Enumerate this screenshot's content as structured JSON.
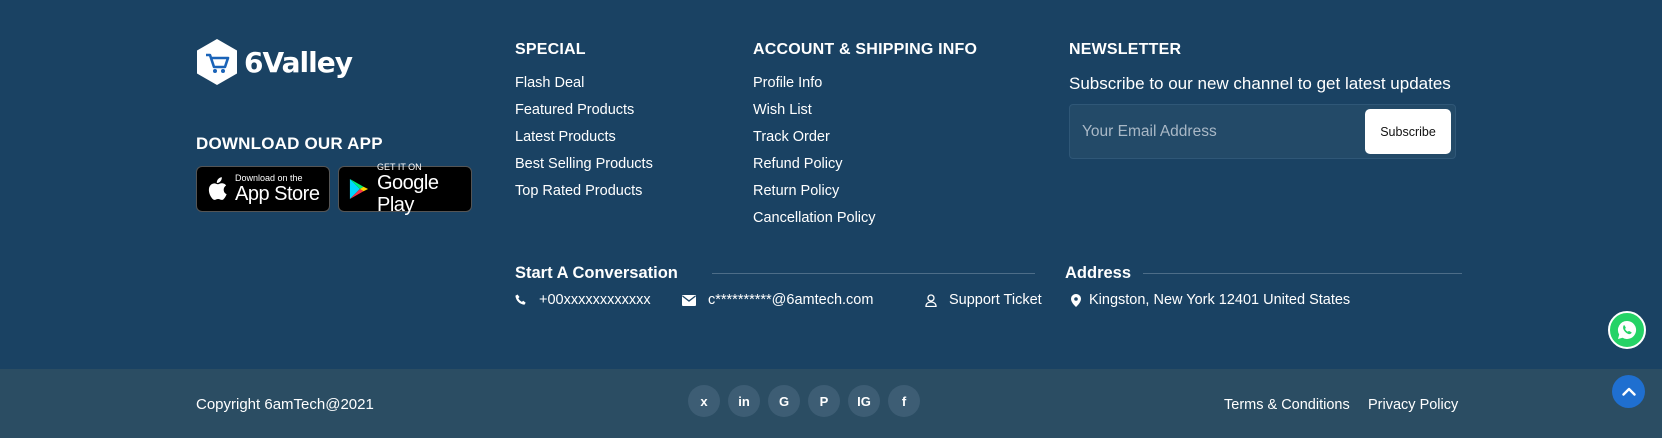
{
  "brand": {
    "name": "6Valley"
  },
  "download": {
    "title": "DOWNLOAD OUR APP",
    "app_store": {
      "small": "Download on the",
      "big": "App Store"
    },
    "google_play": {
      "small": "GET IT ON",
      "big": "Google Play"
    }
  },
  "special": {
    "title": "SPECIAL",
    "items": [
      "Flash Deal",
      "Featured Products",
      "Latest Products",
      "Best Selling Products",
      "Top Rated Products"
    ]
  },
  "account": {
    "title": "ACCOUNT & SHIPPING INFO",
    "items": [
      "Profile Info",
      "Wish List",
      "Track Order",
      "Refund Policy",
      "Return Policy",
      "Cancellation Policy"
    ]
  },
  "newsletter": {
    "title": "NEWSLETTER",
    "subtitle": "Subscribe to our new channel to get latest updates",
    "placeholder": "Your Email Address",
    "button": "Subscribe"
  },
  "conversation": {
    "title": "Start A Conversation",
    "phone": "+00xxxxxxxxxxxx",
    "email": "c**********@6amtech.com",
    "support": "Support Ticket"
  },
  "address": {
    "title": "Address",
    "text": "Kingston, New York 12401 United States"
  },
  "bottom": {
    "copyright": "Copyright 6amTech@2021",
    "social": [
      "x",
      "in",
      "G",
      "P",
      "IG",
      "f"
    ],
    "terms": "Terms & Conditions",
    "privacy": "Privacy Policy"
  },
  "colors": {
    "background": "#1a4263",
    "bottom_bar": "#2b4d63",
    "whatsapp": "#25d366",
    "scroll_top": "#1f6fd0"
  }
}
